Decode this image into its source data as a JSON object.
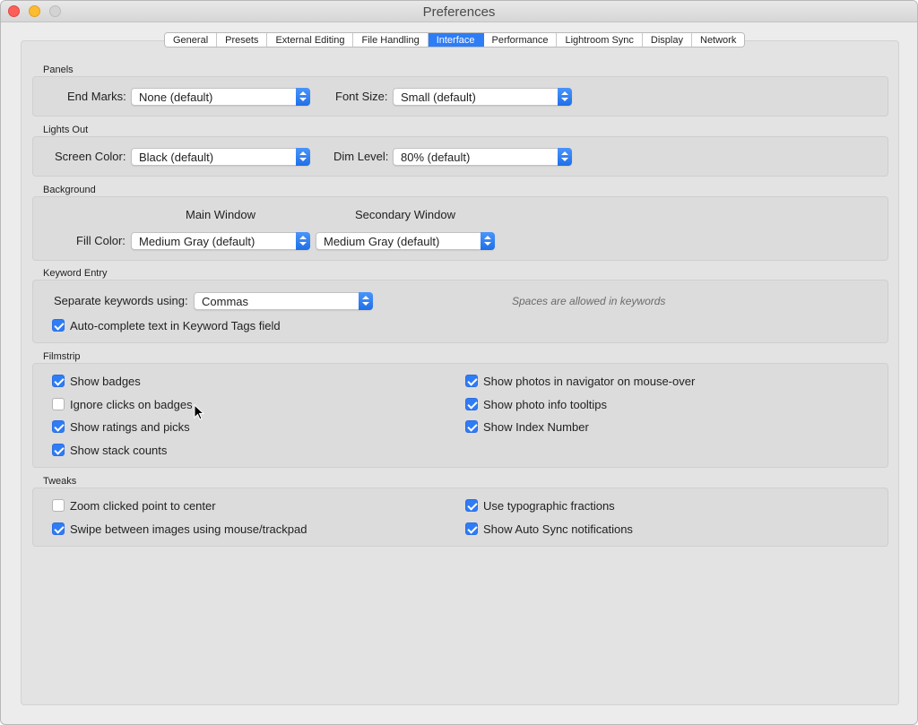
{
  "window": {
    "title": "Preferences"
  },
  "tabs": [
    {
      "label": "General"
    },
    {
      "label": "Presets"
    },
    {
      "label": "External Editing"
    },
    {
      "label": "File Handling"
    },
    {
      "label": "Interface",
      "active": true
    },
    {
      "label": "Performance"
    },
    {
      "label": "Lightroom Sync"
    },
    {
      "label": "Display"
    },
    {
      "label": "Network"
    }
  ],
  "panels": {
    "title": "Panels",
    "end_marks_label": "End Marks:",
    "end_marks_value": "None (default)",
    "font_size_label": "Font Size:",
    "font_size_value": "Small (default)"
  },
  "lights_out": {
    "title": "Lights Out",
    "screen_color_label": "Screen Color:",
    "screen_color_value": "Black (default)",
    "dim_level_label": "Dim Level:",
    "dim_level_value": "80% (default)"
  },
  "background": {
    "title": "Background",
    "main_window_header": "Main Window",
    "secondary_window_header": "Secondary Window",
    "fill_color_label": "Fill Color:",
    "main_fill_value": "Medium Gray (default)",
    "secondary_fill_value": "Medium Gray (default)"
  },
  "keyword_entry": {
    "title": "Keyword Entry",
    "separate_label": "Separate keywords using:",
    "separate_value": "Commas",
    "hint": "Spaces are allowed in keywords",
    "autocomplete_label": "Auto-complete text in Keyword Tags field",
    "autocomplete_checked": true
  },
  "filmstrip": {
    "title": "Filmstrip",
    "left": [
      {
        "label": "Show badges",
        "checked": true
      },
      {
        "label": "Ignore clicks on badges",
        "checked": false
      },
      {
        "label": "Show ratings and picks",
        "checked": true
      },
      {
        "label": "Show stack counts",
        "checked": true
      }
    ],
    "right": [
      {
        "label": "Show photos in navigator on mouse-over",
        "checked": true
      },
      {
        "label": "Show photo info tooltips",
        "checked": true
      },
      {
        "label": "Show Index Number",
        "checked": true
      }
    ]
  },
  "tweaks": {
    "title": "Tweaks",
    "left": [
      {
        "label": "Zoom clicked point to center",
        "checked": false
      },
      {
        "label": "Swipe between images using mouse/trackpad",
        "checked": true
      }
    ],
    "right": [
      {
        "label": "Use typographic fractions",
        "checked": true
      },
      {
        "label": "Show Auto Sync notifications",
        "checked": true
      }
    ]
  }
}
